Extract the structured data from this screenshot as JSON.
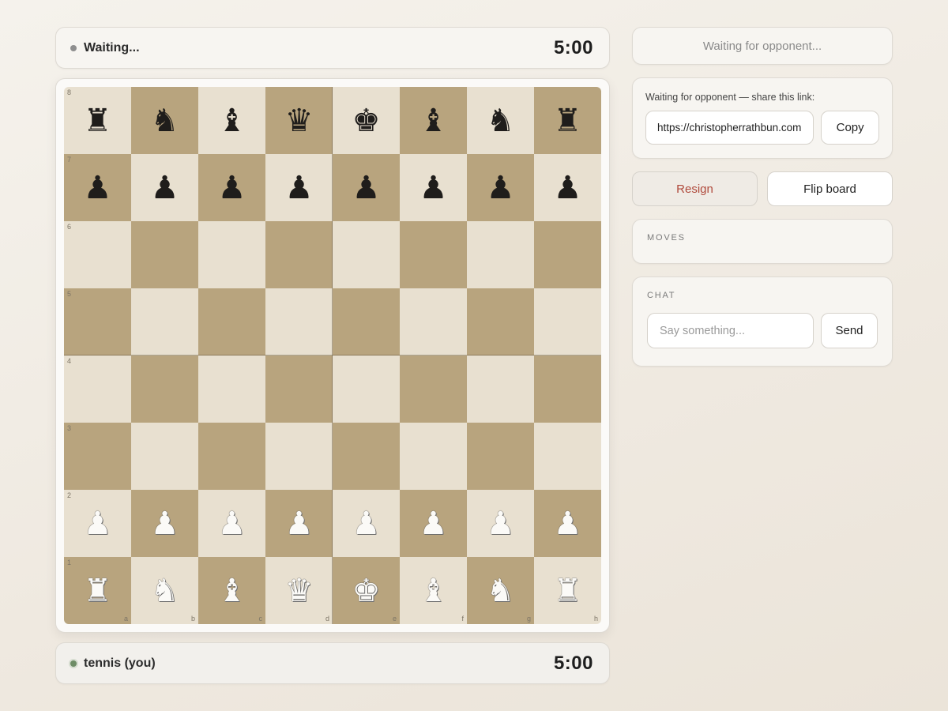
{
  "opponent": {
    "name": "Waiting...",
    "clock": "5:00"
  },
  "player": {
    "name": "tennis (you)",
    "clock": "5:00"
  },
  "status": "Waiting for opponent...",
  "share": {
    "label": "Waiting for opponent — share this link:",
    "link": "https://christopherrathbun.com",
    "copy_label": "Copy"
  },
  "actions": {
    "resign_label": "Resign",
    "flip_label": "Flip board"
  },
  "moves": {
    "title": "MOVES",
    "list": []
  },
  "chat": {
    "title": "CHAT",
    "placeholder": "Say something...",
    "send_label": "Send"
  },
  "colors": {
    "light_square": "#e8e0d0",
    "dark_square": "#b8a47e",
    "resign_text": "#b04a3c"
  },
  "board": {
    "ranks": [
      "8",
      "7",
      "6",
      "5",
      "4",
      "3",
      "2",
      "1"
    ],
    "files": [
      "a",
      "b",
      "c",
      "d",
      "e",
      "f",
      "g",
      "h"
    ],
    "position": [
      [
        "r",
        "n",
        "b",
        "q",
        "k",
        "b",
        "n",
        "r"
      ],
      [
        "p",
        "p",
        "p",
        "p",
        "p",
        "p",
        "p",
        "p"
      ],
      [
        "",
        "",
        "",
        "",
        "",
        "",
        "",
        ""
      ],
      [
        "",
        "",
        "",
        "",
        "",
        "",
        "",
        ""
      ],
      [
        "",
        "",
        "",
        "",
        "",
        "",
        "",
        ""
      ],
      [
        "",
        "",
        "",
        "",
        "",
        "",
        "",
        ""
      ],
      [
        "P",
        "P",
        "P",
        "P",
        "P",
        "P",
        "P",
        "P"
      ],
      [
        "R",
        "N",
        "B",
        "Q",
        "K",
        "B",
        "N",
        "R"
      ]
    ]
  }
}
